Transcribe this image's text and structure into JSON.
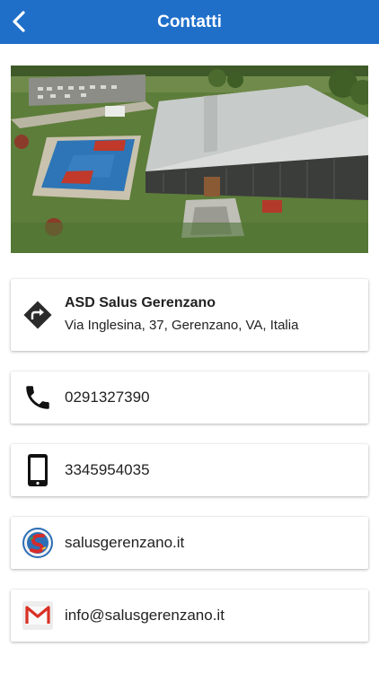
{
  "header": {
    "title": "Contatti"
  },
  "contacts": {
    "address": {
      "name": "ASD Salus Gerenzano",
      "street": "Via Inglesina, 37, Gerenzano, VA, Italia"
    },
    "phone": {
      "value": "0291327390"
    },
    "mobile": {
      "value": "3345954035"
    },
    "website": {
      "value": "salusgerenzano.it"
    },
    "email": {
      "value": "info@salusgerenzano.it"
    }
  },
  "colors": {
    "navbar": "#1f6fc9",
    "gmail_red": "#d93025"
  }
}
